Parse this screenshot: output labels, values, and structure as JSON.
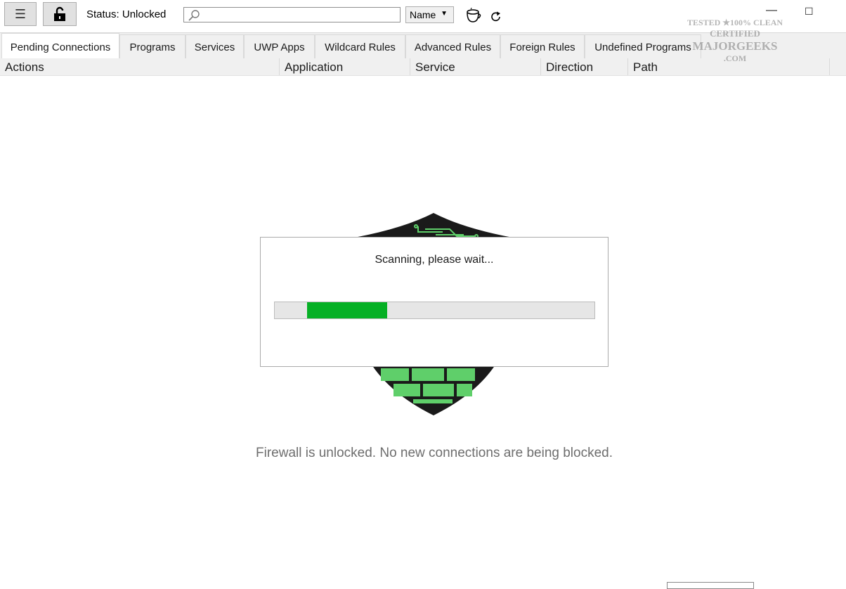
{
  "toolbar": {
    "menu_icon": "hamburger-menu-icon",
    "lock_icon": "unlocked-padlock-icon",
    "status_label": "Status: Unlocked",
    "search_value": "",
    "search_icon": "magnifier-icon",
    "sort_value": "Name",
    "mug_icon": "coffee-mug-icon",
    "refresh_icon": "refresh-icon",
    "minimize_glyph": "—",
    "maximize_glyph": "☐"
  },
  "tabs": [
    {
      "label": "Pending Connections",
      "active": true
    },
    {
      "label": "Programs"
    },
    {
      "label": "Services"
    },
    {
      "label": "UWP Apps"
    },
    {
      "label": "Wildcard Rules"
    },
    {
      "label": "Advanced Rules"
    },
    {
      "label": "Foreign Rules"
    },
    {
      "label": "Undefined Programs"
    }
  ],
  "columns": [
    "Actions",
    "Application",
    "Service",
    "Direction",
    "Path"
  ],
  "dialog": {
    "title": "Scanning, please wait...",
    "progress_fraction": 0.25
  },
  "message": "Firewall is unlocked. No new connections are being blocked.",
  "colors": {
    "progress": "#06b025",
    "shield_green": "#5fcf6a",
    "shield_dark": "#1a1a1a"
  },
  "watermark": {
    "line1": "TESTED ★100% CLEAN",
    "line2": "CERTIFIED",
    "line3": "MAJORGEEKS",
    "line4": ".COM"
  }
}
